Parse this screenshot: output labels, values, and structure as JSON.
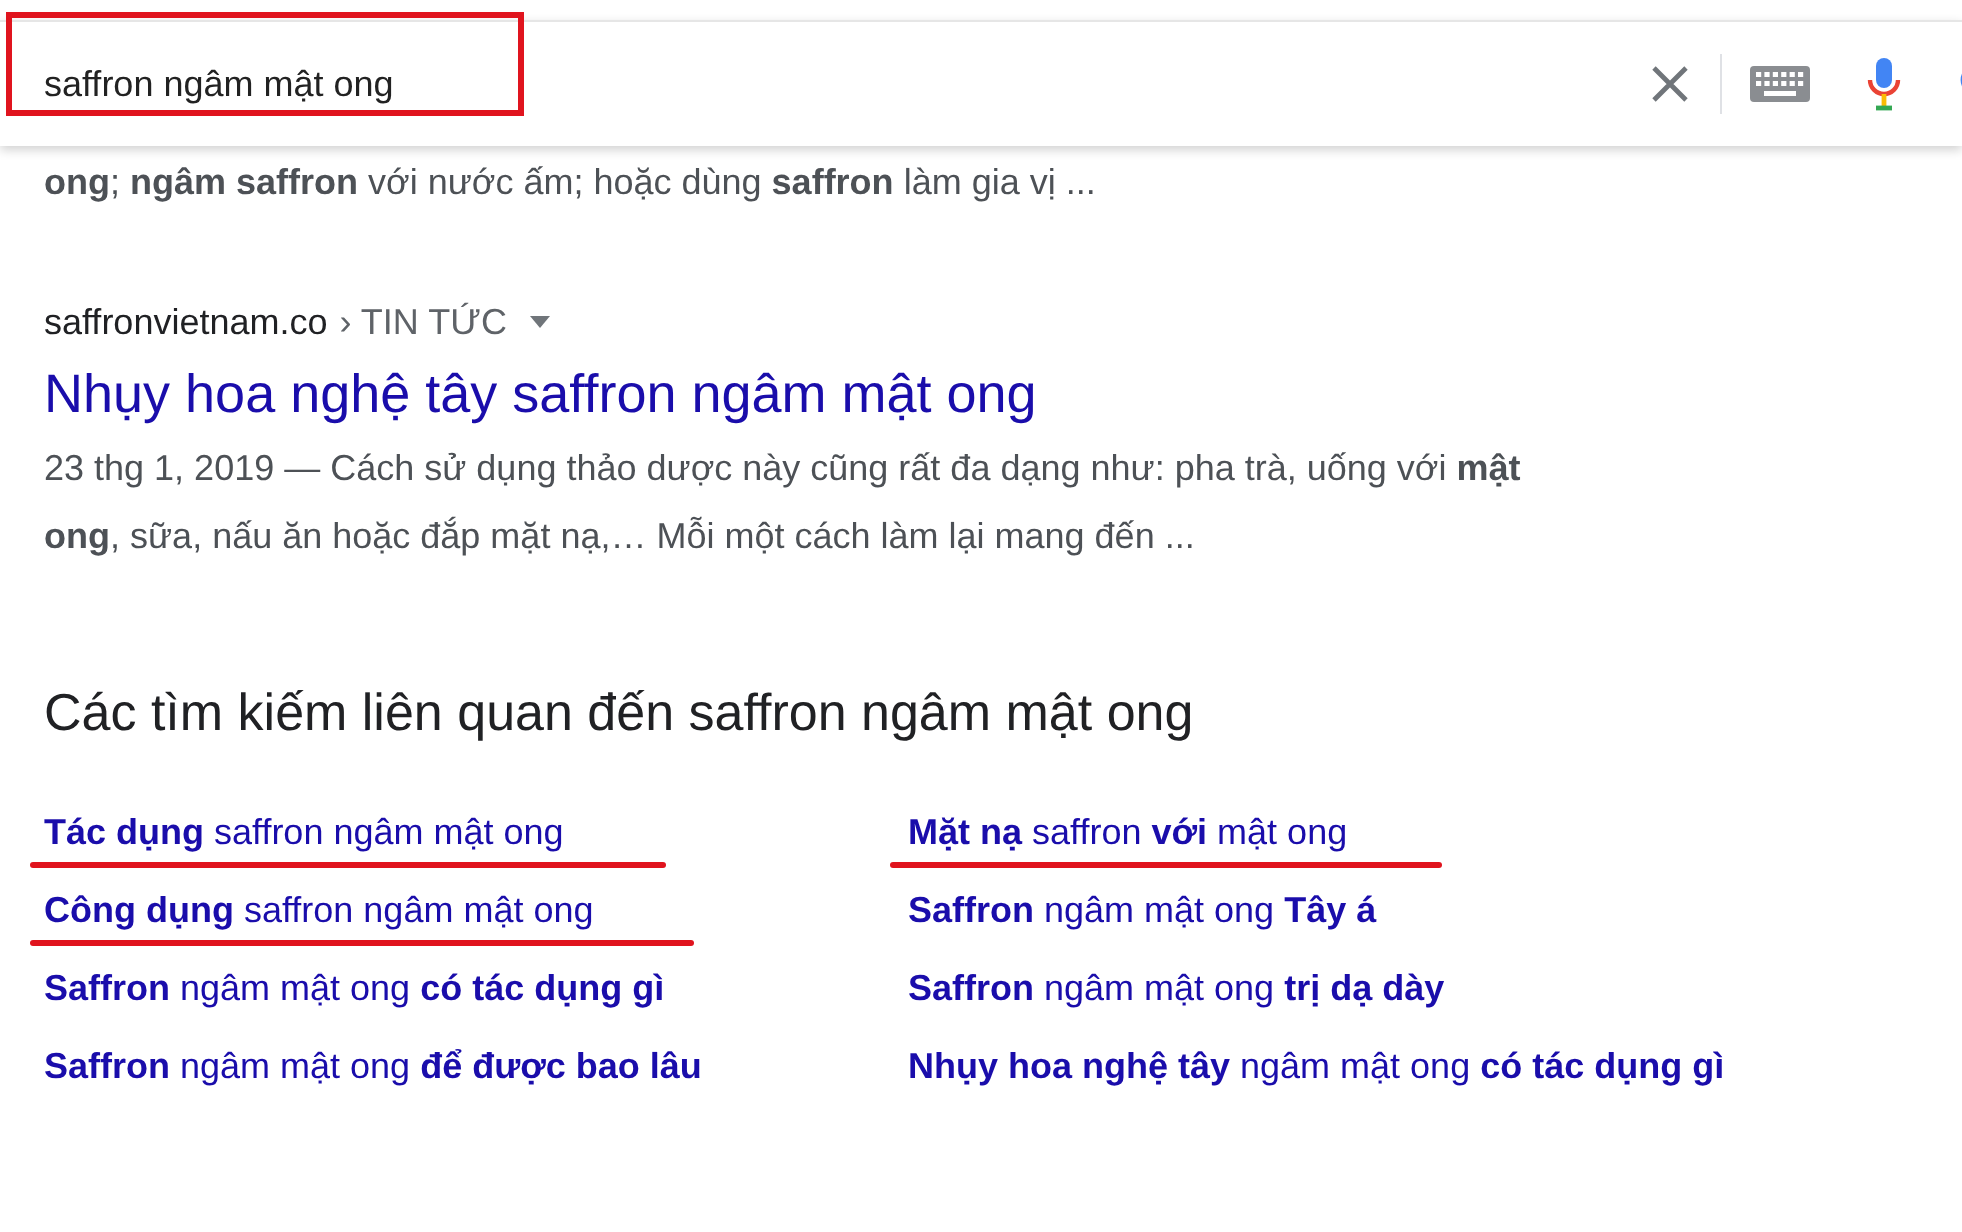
{
  "search": {
    "value": "saffron ngâm mật ong",
    "highlighted": true
  },
  "previous_snippet": "**ong**; **ngâm saffron** với nước ấm; hoặc dùng **saffron** làm gia vị ...",
  "result": {
    "site": "saffronvietnam.co",
    "breadcrumb": "› TIN TỨC",
    "title": "Nhụy hoa nghệ tây saffron ngâm mật ong",
    "snippet_lines": [
      "23 thg 1, 2019 — Cách sử dụng thảo dược này cũng rất đa dạng như: pha trà, uống với **mật**",
      "**ong**, sữa, nấu ăn hoặc đắp mặt nạ,… Mỗi một cách làm lại mang đến ..."
    ]
  },
  "related": {
    "heading": "Các tìm kiếm liên quan đến saffron ngâm mật ong",
    "items": [
      {
        "text": "**Tác dụng** saffron ngâm mật ong",
        "underlined": true
      },
      {
        "text": "**Mặt nạ** saffron **với** mật ong",
        "underlined": true
      },
      {
        "text": "**Công dụng** saffron ngâm mật ong",
        "underlined": true
      },
      {
        "text": "**Saffron** ngâm mật ong **Tây á**",
        "underlined": false
      },
      {
        "text": "**Saffron** ngâm mật ong **có tác dụng gì**",
        "underlined": false
      },
      {
        "text": "**Saffron** ngâm mật ong **trị dạ dày**",
        "underlined": false
      },
      {
        "text": "**Saffron** ngâm mật ong **để được bao lâu**",
        "underlined": false
      },
      {
        "text": "**Nhụy hoa nghệ tây** ngâm mật ong **có tác dụng gì**",
        "underlined": false
      }
    ]
  }
}
